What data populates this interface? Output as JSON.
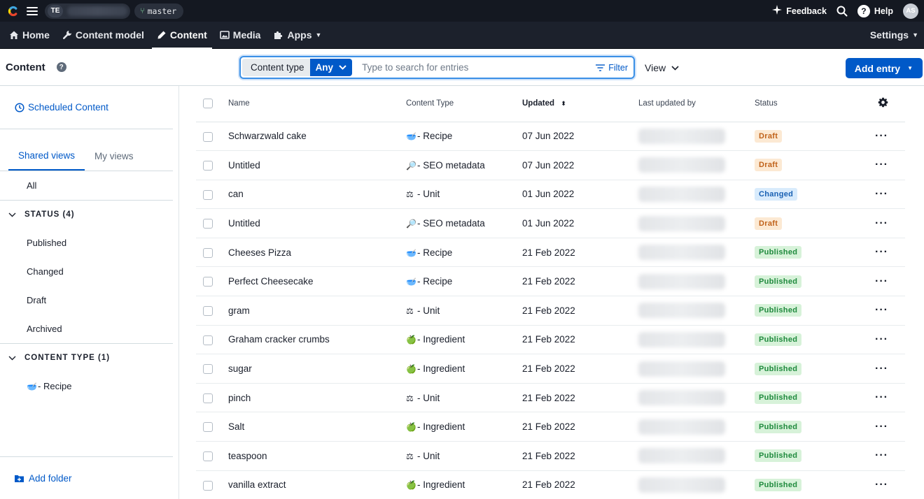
{
  "topbar": {
    "space_initials": "TE",
    "environment": "master",
    "feedback_label": "Feedback",
    "help_label": "Help",
    "avatar_initials": "AS"
  },
  "nav": {
    "items": [
      {
        "label": "Home",
        "icon": "home-icon"
      },
      {
        "label": "Content model",
        "icon": "wrench-icon"
      },
      {
        "label": "Content",
        "icon": "pencil-icon"
      },
      {
        "label": "Media",
        "icon": "image-icon"
      },
      {
        "label": "Apps",
        "icon": "puzzle-icon"
      }
    ],
    "settings_label": "Settings"
  },
  "toolbar": {
    "title": "Content",
    "content_type_label": "Content type",
    "content_type_value": "Any",
    "search_placeholder": "Type to search for entries",
    "filter_label": "Filter",
    "view_label": "View",
    "add_entry_label": "Add entry"
  },
  "sidebar": {
    "scheduled_label": "Scheduled Content",
    "tabs": [
      "Shared views",
      "My views"
    ],
    "all_label": "All",
    "status_section": "STATUS (4)",
    "status_items": [
      "Published",
      "Changed",
      "Draft",
      "Archived"
    ],
    "content_type_section": "CONTENT TYPE (1)",
    "content_type_item": "Recipe",
    "add_folder_label": "Add folder"
  },
  "table": {
    "headers": {
      "name": "Name",
      "content_type": "Content Type",
      "updated": "Updated",
      "last_updated_by": "Last updated by",
      "status": "Status"
    },
    "rows": [
      {
        "name": "Schwarzwald cake",
        "emoji": "🥣",
        "type": "- Recipe",
        "updated": "07 Jun 2022",
        "status": "Draft",
        "status_kind": "draft"
      },
      {
        "name": "Untitled",
        "emoji": "🔎",
        "type": "- SEO metadata",
        "updated": "07 Jun 2022",
        "status": "Draft",
        "status_kind": "draft"
      },
      {
        "name": "can",
        "emoji": "⚖",
        "type": "- Unit",
        "updated": "01 Jun 2022",
        "status": "Changed",
        "status_kind": "changed"
      },
      {
        "name": "Untitled",
        "emoji": "🔎",
        "type": "- SEO metadata",
        "updated": "01 Jun 2022",
        "status": "Draft",
        "status_kind": "draft"
      },
      {
        "name": "Cheeses Pizza",
        "emoji": "🥣",
        "type": "- Recipe",
        "updated": "21 Feb 2022",
        "status": "Published",
        "status_kind": "published"
      },
      {
        "name": "Perfect Cheesecake",
        "emoji": "🥣",
        "type": "- Recipe",
        "updated": "21 Feb 2022",
        "status": "Published",
        "status_kind": "published"
      },
      {
        "name": "gram",
        "emoji": "⚖",
        "type": "- Unit",
        "updated": "21 Feb 2022",
        "status": "Published",
        "status_kind": "published"
      },
      {
        "name": "Graham cracker crumbs",
        "emoji": "🍏",
        "type": "- Ingredient",
        "updated": "21 Feb 2022",
        "status": "Published",
        "status_kind": "published"
      },
      {
        "name": "sugar",
        "emoji": "🍏",
        "type": "- Ingredient",
        "updated": "21 Feb 2022",
        "status": "Published",
        "status_kind": "published"
      },
      {
        "name": "pinch",
        "emoji": "⚖",
        "type": "- Unit",
        "updated": "21 Feb 2022",
        "status": "Published",
        "status_kind": "published"
      },
      {
        "name": "Salt",
        "emoji": "🍏",
        "type": "- Ingredient",
        "updated": "21 Feb 2022",
        "status": "Published",
        "status_kind": "published"
      },
      {
        "name": "teaspoon",
        "emoji": "⚖",
        "type": "- Unit",
        "updated": "21 Feb 2022",
        "status": "Published",
        "status_kind": "published"
      },
      {
        "name": "vanilla extract",
        "emoji": "🍏",
        "type": "- Ingredient",
        "updated": "21 Feb 2022",
        "status": "Published",
        "status_kind": "published"
      }
    ]
  },
  "colors": {
    "primary": "#0059c8",
    "topbar": "#141821",
    "navbar": "#1c212c"
  }
}
